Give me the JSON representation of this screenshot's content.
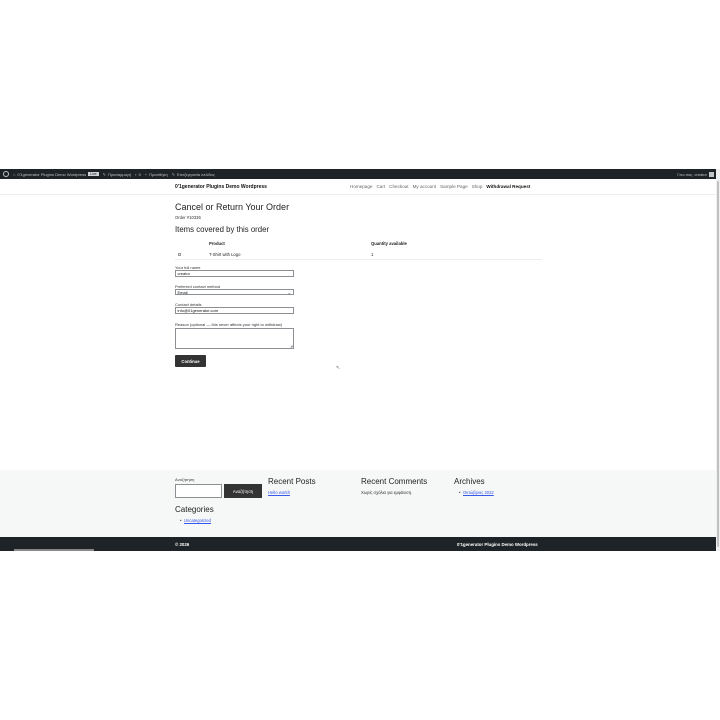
{
  "adminbar": {
    "site_name": "0'1generator Plugins Demo Wordpress",
    "live_badge": "Live",
    "customize": "Προσαρμογή",
    "comments_count": "0",
    "new_label": "Προσθήκη",
    "edit_page": "Επεξεργασία σελίδας",
    "greeting": "Γεια σας, creator"
  },
  "header": {
    "site_title": "0'1generator Plugins Demo Wordpress",
    "nav": [
      "Homepage",
      "Cart",
      "Checkout",
      "My account",
      "Sample Page",
      "Shop"
    ],
    "nav_active": "Withdrawal Request"
  },
  "main": {
    "title": "Cancel or Return Your Order",
    "order_number": "Order #10336",
    "items_title": "Items covered by this order",
    "table": {
      "headers": {
        "product": "Product",
        "quantity": "Quantity available"
      },
      "rows": [
        {
          "product": "T-Shirt with Logo",
          "quantity": "1"
        }
      ]
    },
    "full_name_label": "Your full name",
    "full_name_value": "creator",
    "contact_method_label": "Preferred contact method",
    "contact_method_value": "Email",
    "contact_details_label": "Contact details",
    "contact_details_value": "info@01generator.com",
    "reason_label": "Reason (optional — this never affects your right to withdraw)",
    "continue_button": "Continue"
  },
  "footer_widgets": {
    "search_label": "Αναζήτηση",
    "search_button": "Αναζήτηση",
    "recent_posts_title": "Recent Posts",
    "recent_posts_item": "Hello world!",
    "recent_comments_title": "Recent Comments",
    "recent_comments_text": "Χωρίς σχόλια για εμφάνιση.",
    "archives_title": "Archives",
    "archives_item": "Οκτώβριος 2022",
    "categories_title": "Categories",
    "categories_item": "Uncategorized"
  },
  "footer": {
    "copyright": "© 2026",
    "site_name": "0'1generator Plugins Demo Wordpress"
  }
}
